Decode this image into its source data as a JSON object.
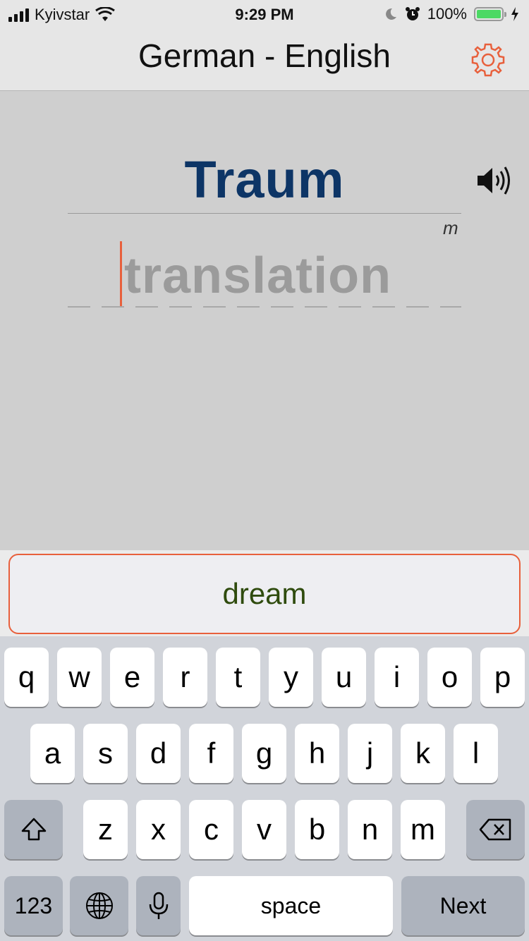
{
  "status": {
    "carrier": "Kyivstar",
    "time": "9:29 PM",
    "battery": "100%",
    "icons": [
      "signal-bars-icon",
      "wifi-icon",
      "moon-icon",
      "alarm-icon",
      "battery-icon",
      "charging-bolt-icon"
    ]
  },
  "nav": {
    "title": "German - English",
    "settings_icon": "gear-icon",
    "accent": "#e8603c"
  },
  "card": {
    "word": "Traum",
    "gender": "m",
    "answer_placeholder": "translation",
    "speaker_icon": "speaker-icon",
    "word_color": "#0d3566"
  },
  "suggestion": {
    "text": "dream"
  },
  "keyboard": {
    "row1": [
      "q",
      "w",
      "e",
      "r",
      "t",
      "y",
      "u",
      "i",
      "o",
      "p"
    ],
    "row2": [
      "a",
      "s",
      "d",
      "f",
      "g",
      "h",
      "j",
      "k",
      "l"
    ],
    "row3": [
      "z",
      "x",
      "c",
      "v",
      "b",
      "n",
      "m"
    ],
    "numbers": "123",
    "space": "space",
    "next": "Next",
    "icons": [
      "shift-icon",
      "backspace-icon",
      "globe-icon",
      "microphone-icon"
    ]
  }
}
